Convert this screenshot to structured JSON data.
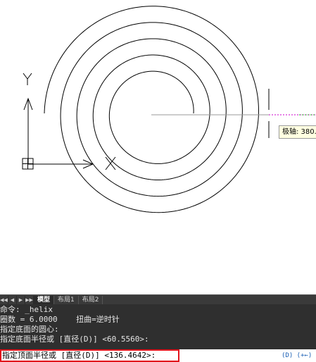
{
  "drawing": {
    "y_axis_label": "Y",
    "x_axis_label": "X",
    "polar_tooltip": "极轴: 380.0"
  },
  "tabs": {
    "items": [
      "模型",
      "布局1",
      "布局2"
    ],
    "active": "模型"
  },
  "console": {
    "history": [
      "命令: _helix",
      "圈数 = 6.0000    扭曲=逆时针",
      "指定底面的圆心:",
      "指定底面半径或 [直径(D)] <60.5560>:"
    ],
    "prompt": "指定顶面半径或 [直径(D)] <136.4642>:",
    "right_fragment": "(D) (+←)"
  },
  "colors": {
    "highlight": "#e1141c",
    "console_bg": "#2f2f2f",
    "tracking": "#cc00cc"
  }
}
